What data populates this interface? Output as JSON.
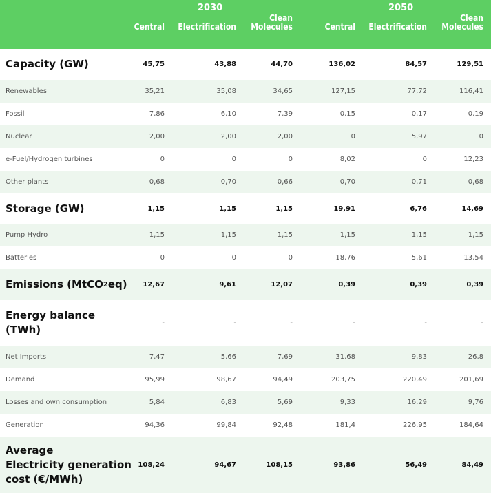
{
  "header": {
    "year1": "2030",
    "year2": "2050",
    "col1": "Central",
    "col2": "Electrification",
    "col3_line1": "Clean",
    "col3_line2": "Molecules",
    "col4": "Central",
    "col5": "Electrification",
    "col6_line1": "Clean",
    "col6_line2": "Molecules"
  },
  "rows": {
    "capacity": {
      "label": "Capacity (GW)",
      "values": [
        "45,75",
        "43,88",
        "44,70",
        "136,02",
        "84,57",
        "129,51"
      ]
    },
    "renewables": {
      "label": "Renewables",
      "values": [
        "35,21",
        "35,08",
        "34,65",
        "127,15",
        "77,72",
        "116,41"
      ]
    },
    "fossil": {
      "label": "Fossil",
      "values": [
        "7,86",
        "6,10",
        "7,39",
        "0,15",
        "0,17",
        "0,19"
      ]
    },
    "nuclear": {
      "label": "Nuclear",
      "values": [
        "2,00",
        "2,00",
        "2,00",
        "0",
        "5,97",
        "0"
      ]
    },
    "efuel": {
      "label": "e-Fuel/Hydrogen turbines",
      "values": [
        "0",
        "0",
        "0",
        "8,02",
        "0",
        "12,23"
      ]
    },
    "other": {
      "label": "Other plants",
      "values": [
        "0,68",
        "0,70",
        "0,66",
        "0,70",
        "0,71",
        "0,68"
      ]
    },
    "storage": {
      "label": "Storage (GW)",
      "values": [
        "1,15",
        "1,15",
        "1,15",
        "19,91",
        "6,76",
        "14,69"
      ]
    },
    "pumphydro": {
      "label": "Pump Hydro",
      "values": [
        "1,15",
        "1,15",
        "1,15",
        "1,15",
        "1,15",
        "1,15"
      ]
    },
    "batteries": {
      "label": "Batteries",
      "values": [
        "0",
        "0",
        "0",
        "18,76",
        "5,61",
        "13,54"
      ]
    },
    "emissions": {
      "label_pre": "Emissions (MtCO",
      "label_sub": "2",
      "label_post": "eq)",
      "values": [
        "12,67",
        "9,61",
        "12,07",
        "0,39",
        "0,39",
        "0,39"
      ]
    },
    "energy": {
      "label_line1": "Energy balance",
      "label_line2": "(TWh)",
      "values": [
        "-",
        "-",
        "-",
        "-",
        "-",
        "-"
      ]
    },
    "netimports": {
      "label": "Net Imports",
      "values": [
        "7,47",
        "5,66",
        "7,69",
        "31,68",
        "9,83",
        "26,8"
      ]
    },
    "demand": {
      "label": "Demand",
      "values": [
        "95,99",
        "98,67",
        "94,49",
        "203,75",
        "220,49",
        "201,69"
      ]
    },
    "losses": {
      "label": "Losses and own consumption",
      "values": [
        "5,84",
        "6,83",
        "5,69",
        "9,33",
        "16,29",
        "9,76"
      ]
    },
    "generation": {
      "label": "Generation",
      "values": [
        "94,36",
        "99,84",
        "92,48",
        "181,4",
        "226,95",
        "184,64"
      ]
    },
    "cost": {
      "label_line1": "Average",
      "label_line2": "Electricity generation",
      "label_line3": "cost (€/MWh)",
      "values": [
        "108,24",
        "94,67",
        "108,15",
        "93,86",
        "56,49",
        "84,49"
      ]
    }
  }
}
